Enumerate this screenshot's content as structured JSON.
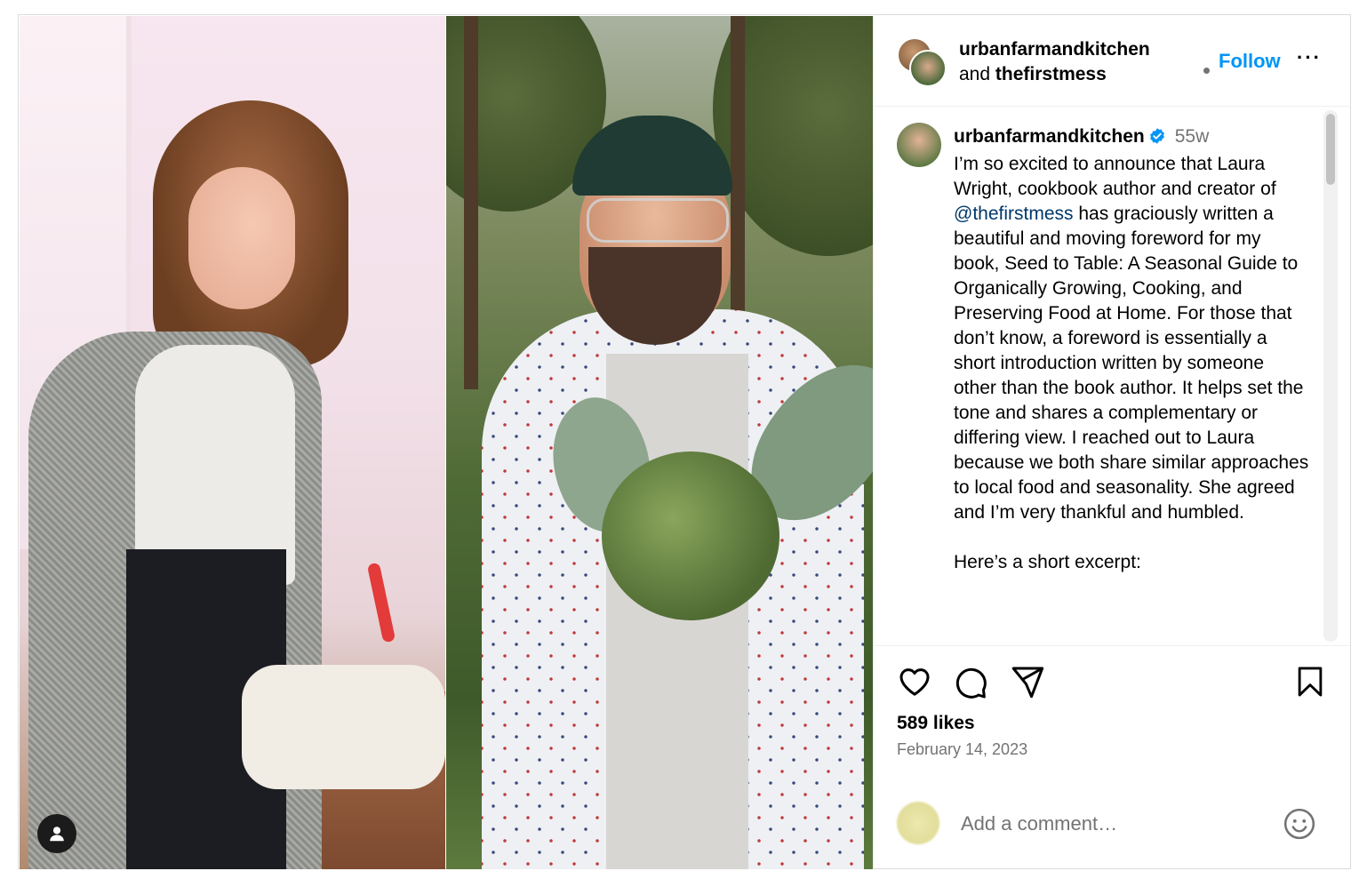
{
  "post": {
    "header": {
      "primary_user": "urbanfarmandkitchen",
      "and_text": "and",
      "collab_user": "thefirstmess",
      "follow_label": "Follow",
      "more_label": "···"
    },
    "caption": {
      "username": "urbanfarmandkitchen",
      "time_ago": "55w",
      "text_part1": "I’m so excited to announce that Laura Wright, cookbook author and creator of",
      "mention": "@thefirstmess",
      "text_part2": "has graciously written a beautiful and moving foreword for my book, Seed to Table: A Seasonal Guide to Organically Growing, Cooking, and Preserving Food at Home. For those that don’t know, a foreword is essentially a short introduction written by someone other than the book author. It helps set the tone and shares a complementary or differing view. I reached out to Laura because we both share similar approaches to local food and seasonality. She agreed and I’m very thankful and humbled.",
      "paragraph2": "Here’s a short excerpt:"
    },
    "likes": "589 likes",
    "date": "February 14, 2023",
    "comment": {
      "placeholder": "Add a comment…"
    }
  },
  "colors": {
    "accent": "#0095f6",
    "mention": "#00376b",
    "muted": "#737373",
    "border": "#dbdbdb",
    "verified": "#0095f6"
  },
  "icons": {
    "like": "heart-icon",
    "comment": "comment-bubble-icon",
    "share": "paper-plane-icon",
    "save": "bookmark-icon",
    "emoji": "smiley-icon",
    "tag": "user-tag-icon",
    "verified": "verified-badge-icon"
  }
}
